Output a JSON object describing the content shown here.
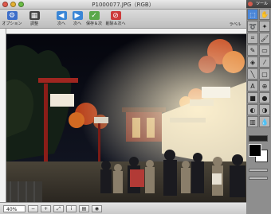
{
  "window": {
    "title": "P1000077.JPG（RGB）"
  },
  "toolbar": {
    "items": [
      {
        "label": "オプション",
        "icon": "options-icon",
        "color": "#3d6ec9"
      },
      {
        "label": "調整",
        "icon": "adjust-icon",
        "color": "#444444"
      },
      {
        "label": "次へ",
        "icon": "arrow-left-icon",
        "color": "#3a86d6"
      },
      {
        "label": "次へ",
        "icon": "arrow-right-icon",
        "color": "#3a86d6"
      },
      {
        "label": "保存＆次",
        "icon": "save-next-icon",
        "color": "#5aa84a"
      },
      {
        "label": "削除＆次へ",
        "icon": "delete-next-icon",
        "color": "#cc3b3b"
      }
    ],
    "right_label": "ラベル"
  },
  "status": {
    "zoom": "40%"
  },
  "panel": {
    "title": "ツール",
    "tools": [
      "select-rect",
      "move-hand",
      "lasso",
      "wand",
      "crop",
      "brush",
      "pencil",
      "eraser",
      "fill",
      "eyedropper",
      "line",
      "shape",
      "text",
      "clone",
      "rect",
      "ellipse",
      "dodge",
      "burn",
      "gradient",
      "blur"
    ],
    "fg_color": "#000000",
    "bg_color": "#ffffff"
  }
}
